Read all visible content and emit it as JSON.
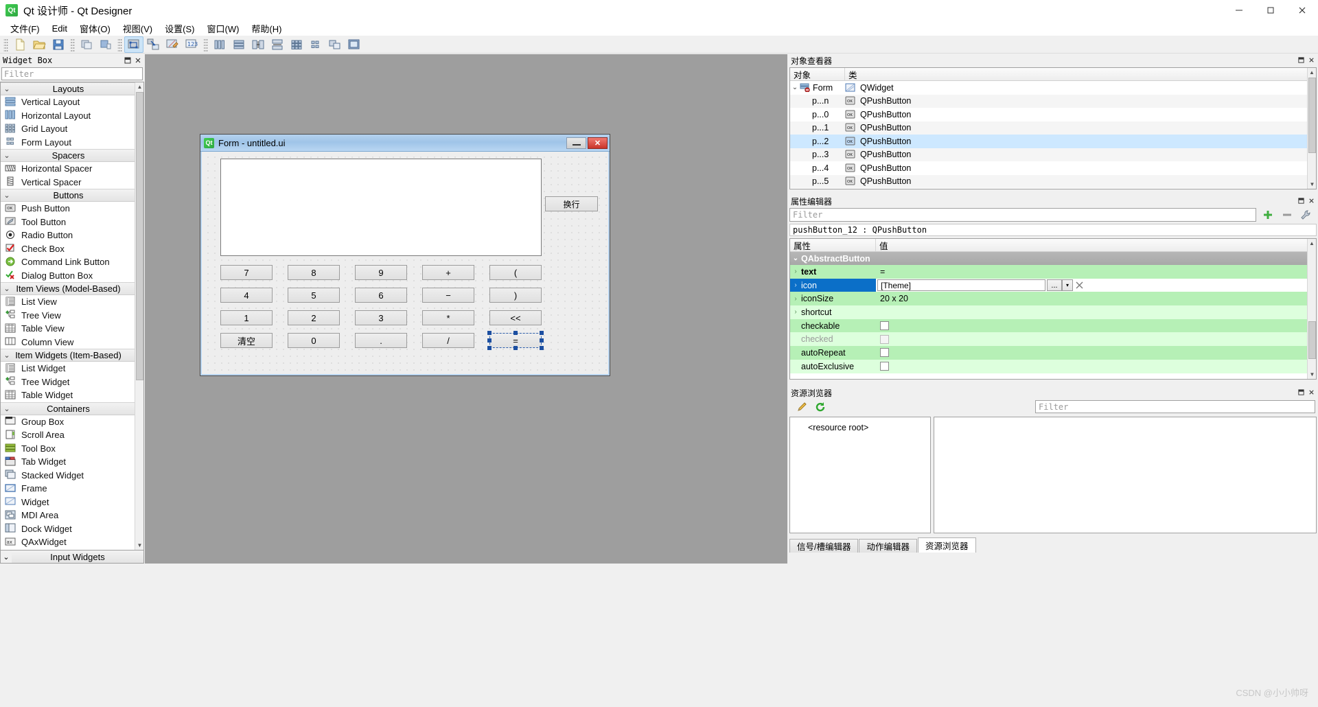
{
  "window": {
    "title": "Qt 设计师 - Qt Designer",
    "icon": "qt-logo-icon",
    "minimize": "–",
    "maximize": "□",
    "close": "✕"
  },
  "menubar": {
    "items": [
      {
        "label": "文件(F)",
        "accel": "F"
      },
      {
        "label": "Edit",
        "accel": "E"
      },
      {
        "label": "窗体(O)",
        "accel": "O"
      },
      {
        "label": "视图(V)",
        "accel": "V"
      },
      {
        "label": "设置(S)",
        "accel": "S"
      },
      {
        "label": "窗口(W)",
        "accel": "W"
      },
      {
        "label": "帮助(H)",
        "accel": "H"
      }
    ]
  },
  "toolbar": {
    "groups": [
      [
        "new-file-icon",
        "open-file-icon",
        "save-file-icon"
      ],
      [
        "undo-icon",
        "redo-icon"
      ],
      [
        "edit-widgets-icon",
        "edit-signals-slots-icon",
        "edit-buddies-icon",
        "edit-tab-order-icon"
      ],
      [
        "layout-horizontally-icon",
        "layout-vertically-icon",
        "layout-in-splitter-h-icon",
        "layout-in-splitter-v-icon",
        "layout-grid-icon",
        "layout-form-icon",
        "break-layout-icon",
        "adjust-size-icon"
      ]
    ]
  },
  "widget_box": {
    "title": "Widget Box",
    "filter_placeholder": "Filter",
    "pin_button": "pin-icon",
    "close_button": "close-icon",
    "categories": [
      {
        "label": "Layouts",
        "expanded": true,
        "items": [
          {
            "label": "Vertical Layout",
            "icon": "vertical-layout-icon"
          },
          {
            "label": "Horizontal Layout",
            "icon": "horizontal-layout-icon"
          },
          {
            "label": "Grid Layout",
            "icon": "grid-layout-icon"
          },
          {
            "label": "Form Layout",
            "icon": "form-layout-icon"
          }
        ]
      },
      {
        "label": "Spacers",
        "expanded": true,
        "items": [
          {
            "label": "Horizontal Spacer",
            "icon": "horizontal-spacer-icon"
          },
          {
            "label": "Vertical Spacer",
            "icon": "vertical-spacer-icon"
          }
        ]
      },
      {
        "label": "Buttons",
        "expanded": true,
        "items": [
          {
            "label": "Push Button",
            "icon": "push-button-icon"
          },
          {
            "label": "Tool Button",
            "icon": "tool-button-icon"
          },
          {
            "label": "Radio Button",
            "icon": "radio-button-icon"
          },
          {
            "label": "Check Box",
            "icon": "check-box-icon"
          },
          {
            "label": "Command Link Button",
            "icon": "command-link-button-icon"
          },
          {
            "label": "Dialog Button Box",
            "icon": "dialog-button-box-icon"
          }
        ]
      },
      {
        "label": "Item Views (Model-Based)",
        "expanded": true,
        "items": [
          {
            "label": "List View",
            "icon": "list-view-icon"
          },
          {
            "label": "Tree View",
            "icon": "tree-view-icon"
          },
          {
            "label": "Table View",
            "icon": "table-view-icon"
          },
          {
            "label": "Column View",
            "icon": "column-view-icon"
          }
        ]
      },
      {
        "label": "Item Widgets (Item-Based)",
        "expanded": true,
        "items": [
          {
            "label": "List Widget",
            "icon": "list-widget-icon"
          },
          {
            "label": "Tree Widget",
            "icon": "tree-widget-icon"
          },
          {
            "label": "Table Widget",
            "icon": "table-widget-icon"
          }
        ]
      },
      {
        "label": "Containers",
        "expanded": true,
        "items": [
          {
            "label": "Group Box",
            "icon": "group-box-icon"
          },
          {
            "label": "Scroll Area",
            "icon": "scroll-area-icon"
          },
          {
            "label": "Tool Box",
            "icon": "tool-box-icon"
          },
          {
            "label": "Tab Widget",
            "icon": "tab-widget-icon"
          },
          {
            "label": "Stacked Widget",
            "icon": "stacked-widget-icon"
          },
          {
            "label": "Frame",
            "icon": "frame-icon"
          },
          {
            "label": "Widget",
            "icon": "widget-icon"
          },
          {
            "label": "MDI Area",
            "icon": "mdi-area-icon"
          },
          {
            "label": "Dock Widget",
            "icon": "dock-widget-icon"
          },
          {
            "label": "QAxWidget",
            "icon": "qaxwidget-icon"
          }
        ]
      }
    ],
    "footer_category": {
      "label": "Input Widgets",
      "expanded": true
    }
  },
  "form": {
    "title": "Form - untitled.ui",
    "icon": "qt-logo-icon",
    "minimize": "minimize-icon",
    "close": "✕",
    "display_value": "",
    "newline_button": "换行",
    "grid": [
      [
        "7",
        "8",
        "9",
        "+",
        "("
      ],
      [
        "4",
        "5",
        "6",
        "−",
        ")"
      ],
      [
        "1",
        "2",
        "3",
        "*",
        "<<"
      ],
      [
        "清空",
        "0",
        ".",
        "/",
        "="
      ]
    ],
    "selected_button": "="
  },
  "object_inspector": {
    "title": "对象查看器",
    "pin_button": "pin-icon",
    "close_button": "close-icon",
    "columns": [
      "对象",
      "类"
    ],
    "rows": [
      {
        "name": "Form",
        "class": "QWidget",
        "icon": "form-widget-icon",
        "level": 0,
        "expanded": true,
        "selected": false
      },
      {
        "name": "p...n",
        "class": "QPushButton",
        "icon": "push-button-icon",
        "level": 1,
        "selected": false
      },
      {
        "name": "p...0",
        "class": "QPushButton",
        "icon": "push-button-icon",
        "level": 1,
        "selected": false
      },
      {
        "name": "p...1",
        "class": "QPushButton",
        "icon": "push-button-icon",
        "level": 1,
        "selected": false
      },
      {
        "name": "p...2",
        "class": "QPushButton",
        "icon": "push-button-icon",
        "level": 1,
        "selected": true
      },
      {
        "name": "p...3",
        "class": "QPushButton",
        "icon": "push-button-icon",
        "level": 1,
        "selected": false
      },
      {
        "name": "p...4",
        "class": "QPushButton",
        "icon": "push-button-icon",
        "level": 1,
        "selected": false
      },
      {
        "name": "p...5",
        "class": "QPushButton",
        "icon": "push-button-icon",
        "level": 1,
        "selected": false
      }
    ]
  },
  "property_editor": {
    "title": "属性编辑器",
    "pin_button": "pin-icon",
    "close_button": "close-icon",
    "filter_placeholder": "Filter",
    "add_button": "add-icon",
    "remove_button": "remove-icon",
    "config_button": "wrench-icon",
    "object_line": "pushButton_12 : QPushButton",
    "columns": [
      "属性",
      "值"
    ],
    "group": "QAbstractButton",
    "rows": [
      {
        "name": "text",
        "value": "=",
        "kind": "text",
        "bold": true,
        "shade": "g1",
        "expandable": true,
        "selected": false
      },
      {
        "name": "icon",
        "value": "[Theme]",
        "kind": "icon-combo",
        "shade": "g1",
        "expandable": true,
        "selected": true
      },
      {
        "name": "iconSize",
        "value": "20 x 20",
        "kind": "text",
        "shade": "g1",
        "expandable": true,
        "selected": false
      },
      {
        "name": "shortcut",
        "value": "",
        "kind": "text",
        "shade": "g2",
        "expandable": true,
        "selected": false
      },
      {
        "name": "checkable",
        "value": false,
        "kind": "checkbox",
        "shade": "g1",
        "selected": false
      },
      {
        "name": "checked",
        "value": false,
        "kind": "checkbox",
        "shade": "g2",
        "disabled": true,
        "selected": false
      },
      {
        "name": "autoRepeat",
        "value": false,
        "kind": "checkbox",
        "shade": "g1",
        "selected": false
      },
      {
        "name": "autoExclusive",
        "value": false,
        "kind": "checkbox",
        "shade": "g2",
        "selected": false
      }
    ]
  },
  "resource_browser": {
    "title": "资源浏览器",
    "pin_button": "pin-icon",
    "close_button": "close-icon",
    "edit_button": "pencil-icon",
    "reload_button": "reload-icon",
    "filter_placeholder": "Filter",
    "root_label": "<resource root>",
    "tabs": [
      {
        "label": "信号/槽编辑器",
        "active": false
      },
      {
        "label": "动作编辑器",
        "active": false
      },
      {
        "label": "资源浏览器",
        "active": true
      }
    ]
  },
  "watermark": "CSDN @小小帅呀"
}
